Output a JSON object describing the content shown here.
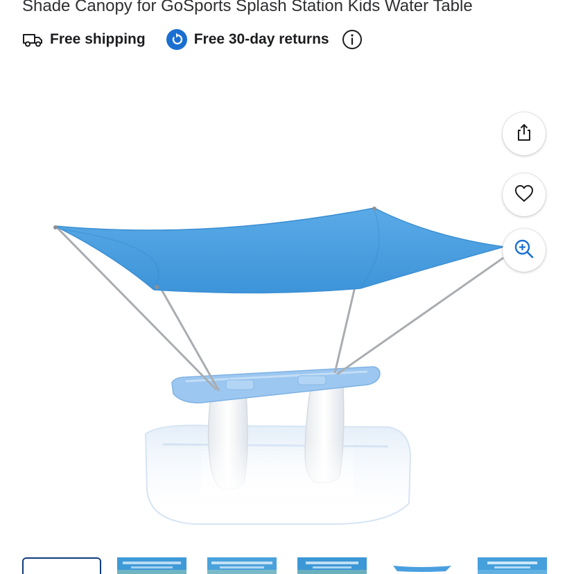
{
  "product": {
    "title": "Shade Canopy for GoSports Splash Station Kids Water Table"
  },
  "badges": {
    "shipping_label": "Free shipping",
    "returns_label": "Free 30-day returns",
    "shipping_icon": "truck-icon",
    "returns_icon": "return-arrow-icon",
    "info_icon": "info-icon"
  },
  "actions": {
    "share_icon": "share-icon",
    "favorite_icon": "heart-icon",
    "zoom_icon": "zoom-in-icon"
  },
  "gallery": {
    "selected_index": 0,
    "thumbnail_count": 6
  },
  "colors": {
    "returns_badge": "#1a6fd1",
    "canopy": "#4a9fe0",
    "selected_thumb_border": "#0f3a7d",
    "text": "#2e2f32"
  }
}
